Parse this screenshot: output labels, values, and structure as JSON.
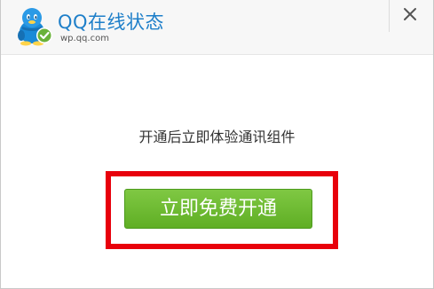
{
  "header": {
    "title": "QQ在线状态",
    "url": "wp.qq.com"
  },
  "content": {
    "message": "开通后立即体验通讯组件",
    "cta_label": "立即免费开通"
  },
  "colors": {
    "brand_blue": "#1e7fc9",
    "cta_green": "#6cb92f",
    "highlight_red": "#e8000b",
    "status_check": "#6ab23a"
  },
  "icons": {
    "logo": "qq-penguin-online-icon",
    "close": "close-icon"
  }
}
